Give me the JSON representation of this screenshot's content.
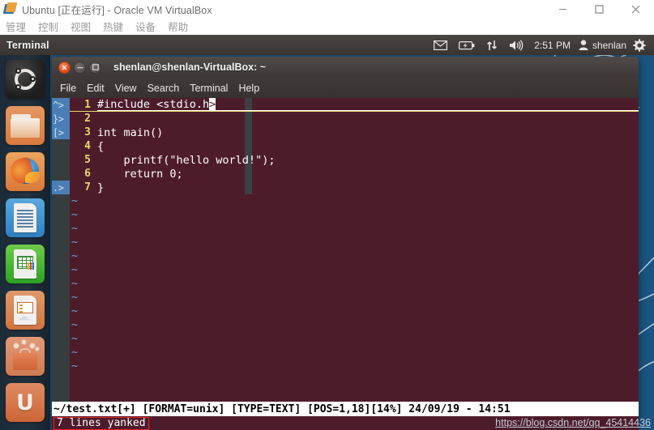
{
  "host_window": {
    "title": "Ubuntu [正在运行] - Oracle VM VirtualBox",
    "icon": "virtualbox-icon",
    "controls": {
      "minimize": "minimize-icon",
      "maximize": "maximize-icon",
      "close": "close-icon"
    },
    "menu": [
      "管理",
      "控制",
      "视图",
      "热键",
      "设备",
      "帮助"
    ]
  },
  "unity_panel": {
    "app_name": "Terminal",
    "indicators": {
      "messaging": "envelope-icon",
      "battery": "battery-icon",
      "network": "network-updown-icon",
      "sound": "volume-icon",
      "clock": "2:51 PM",
      "user_icon": "user-icon",
      "user_name": "shenlan",
      "session": "gear-icon"
    }
  },
  "launcher": {
    "items": [
      {
        "name": "ubuntu-dash",
        "label": "Dash home"
      },
      {
        "name": "files",
        "label": "Files"
      },
      {
        "name": "firefox",
        "label": "Firefox Web Browser"
      },
      {
        "name": "libreoffice-writer",
        "label": "LibreOffice Writer"
      },
      {
        "name": "libreoffice-calc",
        "label": "LibreOffice Calc"
      },
      {
        "name": "libreoffice-impress",
        "label": "LibreOffice Impress"
      },
      {
        "name": "ubuntu-software-center",
        "label": "Ubuntu Software Center"
      },
      {
        "name": "ubuntu-one",
        "label": "Ubuntu One"
      }
    ]
  },
  "terminal": {
    "title": "shenlan@shenlan-VirtualBox: ~",
    "menu": [
      "File",
      "Edit",
      "View",
      "Search",
      "Terminal",
      "Help"
    ],
    "controls": {
      "close": "close-icon",
      "minimize": "minimize-icon",
      "maximize": "maximize-icon"
    }
  },
  "vim": {
    "gutter_marks": [
      "^>",
      "}>",
      "[>"
    ],
    "gutter_mark_bottom": ".>",
    "lines": [
      {
        "num": "1",
        "text": "#include <stdio.h",
        "cursor_char": ">",
        "cursorline": true
      },
      {
        "num": "2",
        "text": "",
        "cursorline": false
      },
      {
        "num": "3",
        "text": "int main()",
        "cursorline": false
      },
      {
        "num": "4",
        "text": "{",
        "cursorline": false
      },
      {
        "num": "5",
        "text": "    printf(\"hello world!\");",
        "cursorline": false
      },
      {
        "num": "6",
        "text": "    return 0;",
        "cursorline": false
      },
      {
        "num": "7",
        "text": "}",
        "cursorline": false
      }
    ],
    "tilde_count": 13,
    "tilde": "~",
    "status_line": "~/test.txt[+] [FORMAT=unix] [TYPE=TEXT] [POS=1,18][14%] 24/09/19 - 14:51",
    "command_line": "7 lines yanked"
  },
  "watermark": "https://blog.csdn.net/qq_45414436",
  "colors": {
    "terminal_bg": "#4d1c2b",
    "vim_linenum": "#e8d96a",
    "vim_tilde": "#6f9fd8",
    "gutter_mark_bg": "#4a7fb5",
    "status_bg": "#ffffff",
    "annotation": "#ee2222",
    "unity_panel": "#413c3a",
    "launcher_bg": "#21313f",
    "desktop": "#1b5480"
  }
}
